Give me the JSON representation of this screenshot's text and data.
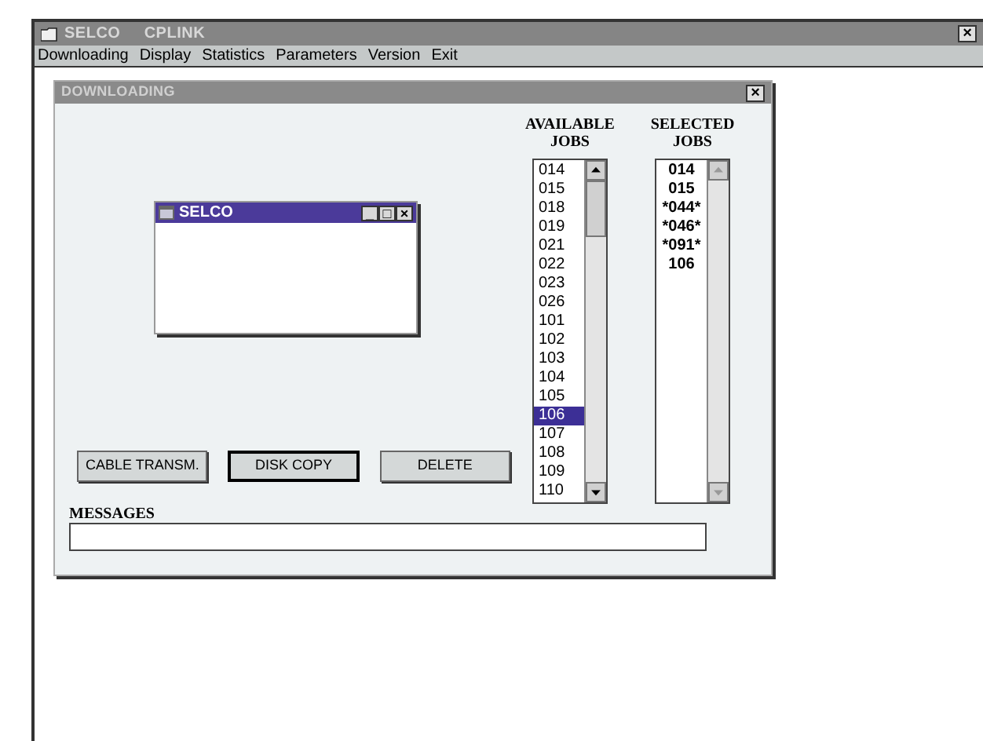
{
  "window": {
    "title": "SELCO     CPLINK",
    "close": "×"
  },
  "menu": [
    "Downloading",
    "Display",
    "Statistics",
    "Parameters",
    "Version",
    "Exit"
  ],
  "dialog": {
    "title": "DOWNLOADING",
    "close": "×",
    "child_window": {
      "title": "SELCO",
      "buttons": [
        "_",
        "□",
        "×"
      ]
    },
    "available": {
      "heading": "AVAILABLE JOBS",
      "items": [
        {
          "label": "014",
          "selected": false
        },
        {
          "label": "015",
          "selected": false
        },
        {
          "label": "018",
          "selected": false
        },
        {
          "label": "019",
          "selected": false
        },
        {
          "label": "021",
          "selected": false
        },
        {
          "label": "022",
          "selected": false
        },
        {
          "label": "023",
          "selected": false
        },
        {
          "label": "026",
          "selected": false
        },
        {
          "label": "101",
          "selected": false
        },
        {
          "label": "102",
          "selected": false
        },
        {
          "label": "103",
          "selected": false
        },
        {
          "label": "104",
          "selected": false
        },
        {
          "label": "105",
          "selected": false
        },
        {
          "label": "106",
          "selected": true
        },
        {
          "label": "107",
          "selected": false
        },
        {
          "label": "108",
          "selected": false
        },
        {
          "label": "109",
          "selected": false
        },
        {
          "label": "110",
          "selected": false
        }
      ]
    },
    "selected_jobs": {
      "heading": "SELECTED JOBS",
      "items": [
        "014",
        "015",
        "*044*",
        "*046*",
        "*091*",
        "106"
      ]
    },
    "buttons": [
      {
        "label": "CABLE TRANSM.",
        "default": false
      },
      {
        "label": "DISK COPY",
        "default": true
      },
      {
        "label": "DELETE",
        "default": false
      }
    ],
    "messages": {
      "label": "MESSAGES"
    }
  }
}
